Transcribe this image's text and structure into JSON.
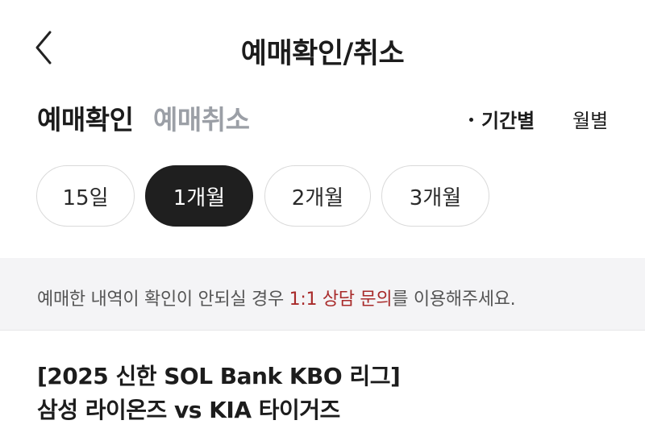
{
  "header": {
    "title": "예매확인/취소",
    "back_icon": "chevron-left-icon"
  },
  "tabs": {
    "confirm_label": "예매확인",
    "cancel_label": "예매취소",
    "active": "예매확인"
  },
  "filters": {
    "period_label": "기간별",
    "monthly_label": "월별",
    "active": "기간별"
  },
  "period_buttons": {
    "d15": "15일",
    "m1": "1개월",
    "m2": "2개월",
    "m3": "3개월",
    "selected": "1개월"
  },
  "notice": {
    "before": "예매한 내역이 확인이 안되실 경우 ",
    "link": "1:1 상담 문의",
    "after": "를 이용해주세요.",
    "link_color": "#a82a2a"
  },
  "game": {
    "line1": "[2025 신한 SOL Bank KBO 리그]",
    "line2": "삼성 라이온즈 vs KIA 타이거즈"
  },
  "colors": {
    "active_pill_bg": "#1f1f1f",
    "inactive_tab": "#9b9fa6",
    "notice_bg": "#f4f4f6"
  }
}
